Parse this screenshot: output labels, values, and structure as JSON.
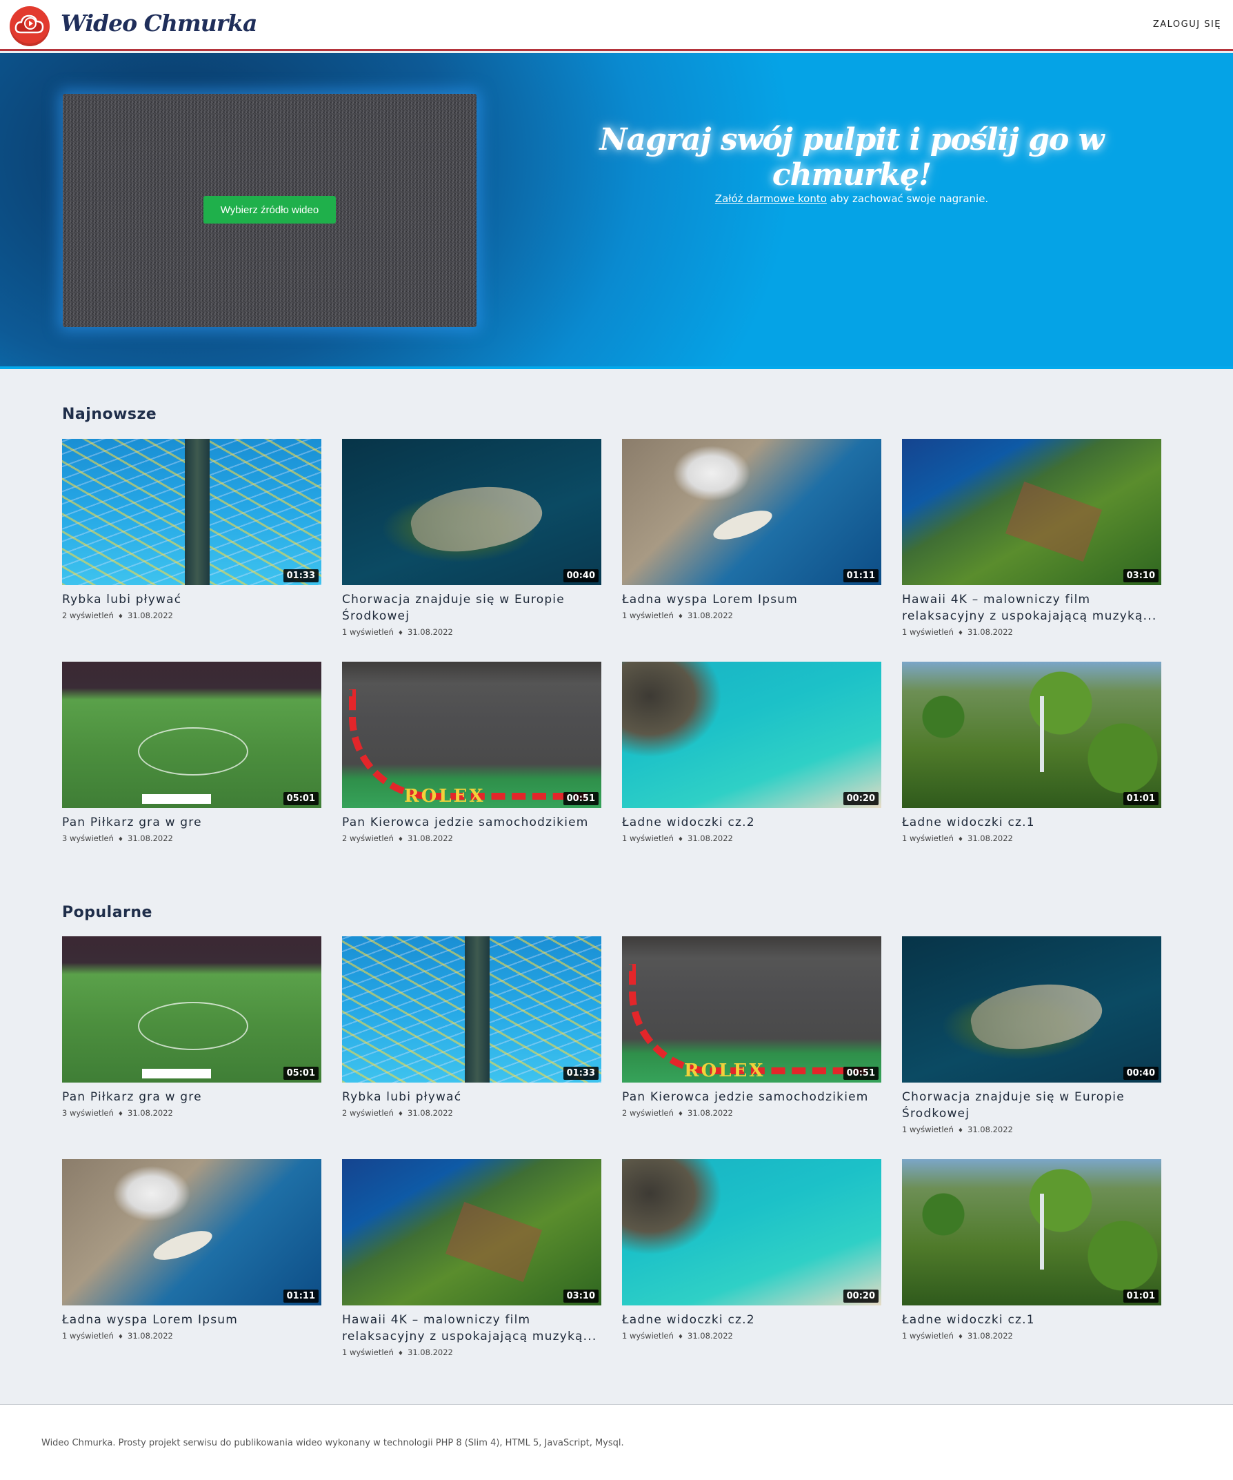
{
  "header": {
    "logo_text": "Wideo Chmurka",
    "login_label": "ZALOGUJ SIĘ"
  },
  "hero": {
    "source_button": "Wybierz źródło wideo",
    "title": "Nagraj swój pulpit i poślij go w chmurkę!",
    "subtitle_link": "Załóż darmowe konto",
    "subtitle_rest": " aby zachować swoje nagranie."
  },
  "sections": {
    "newest": {
      "title": "Najnowsze",
      "videos": [
        {
          "title": "Rybka lubi pływać",
          "views": "2 wyświetleń",
          "date": "31.08.2022",
          "duration": "01:33",
          "thumb": "fish"
        },
        {
          "title": "Chorwacja znajduje się w Europie Środkowej",
          "views": "1 wyświetleń",
          "date": "31.08.2022",
          "duration": "00:40",
          "thumb": "croatia"
        },
        {
          "title": "Ładna wyspa Lorem Ipsum",
          "views": "1 wyświetleń",
          "date": "31.08.2022",
          "duration": "01:11",
          "thumb": "zakynthos"
        },
        {
          "title": "Hawaii 4K – malowniczy film relaksacyjny z uspokajającą muzyką...",
          "views": "1 wyświetleń",
          "date": "31.08.2022",
          "duration": "03:10",
          "thumb": "hawaii"
        },
        {
          "title": "Pan Piłkarz gra w gre",
          "views": "3 wyświetleń",
          "date": "31.08.2022",
          "duration": "05:01",
          "thumb": "football"
        },
        {
          "title": "Pan Kierowca jedzie samochodzikiem",
          "views": "2 wyświetleń",
          "date": "31.08.2022",
          "duration": "00:51",
          "thumb": "f1"
        },
        {
          "title": "Ładne widoczki cz.2",
          "views": "1 wyświetleń",
          "date": "31.08.2022",
          "duration": "00:20",
          "thumb": "lagoon"
        },
        {
          "title": "Ładne widoczki cz.1",
          "views": "1 wyświetleń",
          "date": "31.08.2022",
          "duration": "01:01",
          "thumb": "forest"
        }
      ]
    },
    "popular": {
      "title": "Popularne",
      "videos": [
        {
          "title": "Pan Piłkarz gra w gre",
          "views": "3 wyświetleń",
          "date": "31.08.2022",
          "duration": "05:01",
          "thumb": "football"
        },
        {
          "title": "Rybka lubi pływać",
          "views": "2 wyświetleń",
          "date": "31.08.2022",
          "duration": "01:33",
          "thumb": "fish"
        },
        {
          "title": "Pan Kierowca jedzie samochodzikiem",
          "views": "2 wyświetleń",
          "date": "31.08.2022",
          "duration": "00:51",
          "thumb": "f1"
        },
        {
          "title": "Chorwacja znajduje się w Europie Środkowej",
          "views": "1 wyświetleń",
          "date": "31.08.2022",
          "duration": "00:40",
          "thumb": "croatia"
        },
        {
          "title": "Ładna wyspa Lorem Ipsum",
          "views": "1 wyświetleń",
          "date": "31.08.2022",
          "duration": "01:11",
          "thumb": "zakynthos"
        },
        {
          "title": "Hawaii 4K – malowniczy film relaksacyjny z uspokajającą muzyką...",
          "views": "1 wyświetleń",
          "date": "31.08.2022",
          "duration": "03:10",
          "thumb": "hawaii"
        },
        {
          "title": "Ładne widoczki cz.2",
          "views": "1 wyświetleń",
          "date": "31.08.2022",
          "duration": "00:20",
          "thumb": "lagoon"
        },
        {
          "title": "Ładne widoczki cz.1",
          "views": "1 wyświetleń",
          "date": "31.08.2022",
          "duration": "01:01",
          "thumb": "forest"
        }
      ]
    }
  },
  "footer": {
    "text": "Wideo Chmurka. Prosty projekt serwisu do publikowania wideo wykonany w technologii PHP 8 (Slim 4), HTML 5, JavaScript, Mysql."
  },
  "colors": {
    "brand_red": "#e23a2e",
    "header_border": "#b4343b",
    "hero_blue": "#05a3e6",
    "button_green": "#1fb04b"
  }
}
